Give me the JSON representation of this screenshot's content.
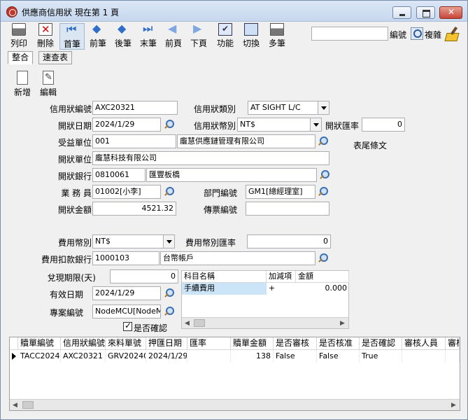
{
  "window": {
    "title": "供應商信用狀  現在第 1 頁"
  },
  "toolbar": {
    "print": "列印",
    "delete": "刪除",
    "first": "首筆",
    "prev": "前筆",
    "next": "後筆",
    "last": "末筆",
    "prev_page": "前頁",
    "next_page": "下頁",
    "function": "功能",
    "switch": "切換",
    "multi": "多筆"
  },
  "search": {
    "value": "",
    "number_label": "編號",
    "complex_label": "複雜"
  },
  "view_tabs": {
    "integrated": "整合",
    "quick_table": "速查表"
  },
  "sub_toolbar": {
    "new": "新增",
    "edit": "編輯"
  },
  "form": {
    "lc_number_label": "信用狀編號",
    "lc_number": "AXC20321",
    "lc_type_label": "信用狀類別",
    "lc_type": "AT SIGHT L/C",
    "open_date_label": "開狀日期",
    "open_date": "2024/1/29",
    "lc_currency_label": "信用狀幣別",
    "lc_currency": "NT$",
    "open_rate_label": "開狀匯率",
    "open_rate": "0",
    "beneficiary_label": "受益單位",
    "beneficiary_code": "001",
    "beneficiary_name": "龐慧供應鏈管理有限公司",
    "end_text_label": "表尾條文",
    "issuer_label": "開狀單位",
    "issuer": "龐慧科技有限公司",
    "bank_label": "開狀銀行",
    "bank_code": "0810061",
    "bank_name": "匯豐板橋",
    "staff_label": "業 務 員",
    "staff": "01002[小李]",
    "dept_label": "部門編號",
    "dept": "GM1[總經理室]",
    "amount_label": "開狀金額",
    "amount": "4521.32",
    "voucher_label": "傳票編號",
    "voucher": "",
    "fee_currency_label": "費用幣別",
    "fee_currency": "NT$",
    "fee_rate_label": "費用幣別匯率",
    "fee_rate": "0",
    "fee_bank_label": "費用扣款銀行",
    "fee_bank_code": "1000103",
    "fee_bank_name": "台幣帳戶",
    "days_label": "兌現期限(天)",
    "days": "0",
    "expiry_label": "有效日期",
    "expiry": "2024/1/29",
    "project_label": "專案編號",
    "project": "NodeMCU[NodeMC",
    "confirmed_label": "是否確認"
  },
  "fee_grid": {
    "columns": [
      "科目名稱",
      "加減項",
      "金額"
    ],
    "rows": [
      [
        "手續費用",
        "+",
        "0.000"
      ]
    ]
  },
  "main_grid": {
    "columns": [
      "贖單編號",
      "信用狀編號",
      "來料單號",
      "押匯日期",
      "匯率",
      "贖單金額",
      "是否審核",
      "是否核准",
      "是否確認",
      "審核人員",
      "審核"
    ],
    "rows": [
      [
        "TACC20240",
        "AXC20321",
        "GRV202401",
        "2024/1/29",
        "",
        "138",
        "False",
        "False",
        "True",
        "",
        ""
      ]
    ]
  }
}
